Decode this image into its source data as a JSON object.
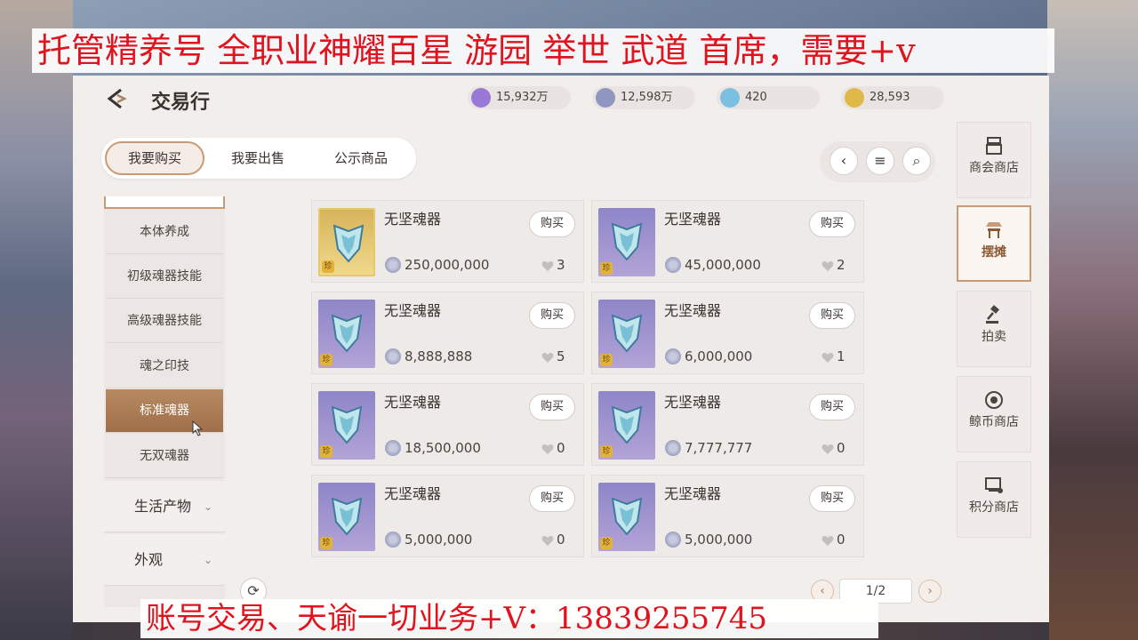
{
  "banner_text": "托管精养号 全职业神耀百星 游园 举世 武道 首席，需要+v",
  "footer_text": "账号交易、天谕一切业务+V：13839255745",
  "header": {
    "title": "交易行",
    "currencies": [
      {
        "icon": "purple-crystal-icon",
        "value": "15,932万",
        "color": "#9a78d6"
      },
      {
        "icon": "silver-coin-icon",
        "value": "12,598万",
        "color": "#8f97c0"
      },
      {
        "icon": "blue-gem-icon",
        "value": "420",
        "color": "#7bc0e0"
      },
      {
        "icon": "gold-coin-icon",
        "value": "28,593",
        "color": "#e0b84a"
      }
    ]
  },
  "tabs": [
    {
      "label": "我要购买",
      "active": true
    },
    {
      "label": "我要出售",
      "active": false
    },
    {
      "label": "公示商品",
      "active": false
    }
  ],
  "categories": [
    {
      "label": "本体养成",
      "active": false
    },
    {
      "label": "初级魂器技能",
      "active": false
    },
    {
      "label": "高级魂器技能",
      "active": false
    },
    {
      "label": "魂之印技",
      "active": false
    },
    {
      "label": "标准魂器",
      "active": true
    },
    {
      "label": "无双魂器",
      "active": false
    }
  ],
  "category_groups": [
    {
      "label": "生活产物"
    },
    {
      "label": "外观"
    }
  ],
  "buy_label": "购买",
  "rare_badge": "珍",
  "listings": [
    {
      "name": "无坚魂器",
      "price": "250,000,000",
      "likes": "3",
      "gold": true
    },
    {
      "name": "无坚魂器",
      "price": "45,000,000",
      "likes": "2",
      "gold": false
    },
    {
      "name": "无坚魂器",
      "price": "8,888,888",
      "likes": "5",
      "gold": false
    },
    {
      "name": "无坚魂器",
      "price": "6,000,000",
      "likes": "1",
      "gold": false
    },
    {
      "name": "无坚魂器",
      "price": "18,500,000",
      "likes": "0",
      "gold": false
    },
    {
      "name": "无坚魂器",
      "price": "7,777,777",
      "likes": "0",
      "gold": false
    },
    {
      "name": "无坚魂器",
      "price": "5,000,000",
      "likes": "0",
      "gold": false
    },
    {
      "name": "无坚魂器",
      "price": "5,000,000",
      "likes": "0",
      "gold": false
    }
  ],
  "pagination": {
    "label": "1/2"
  },
  "side_nav": [
    {
      "label": "商会商店",
      "icon": "guild-shop-icon",
      "active": false
    },
    {
      "label": "摆摊",
      "icon": "stall-icon",
      "active": true
    },
    {
      "label": "拍卖",
      "icon": "auction-hammer-icon",
      "active": false
    },
    {
      "label": "鲸币商店",
      "icon": "whale-coin-icon",
      "active": false
    },
    {
      "label": "积分商店",
      "icon": "points-shop-icon",
      "active": false
    }
  ],
  "accent_color": "#c99a76"
}
